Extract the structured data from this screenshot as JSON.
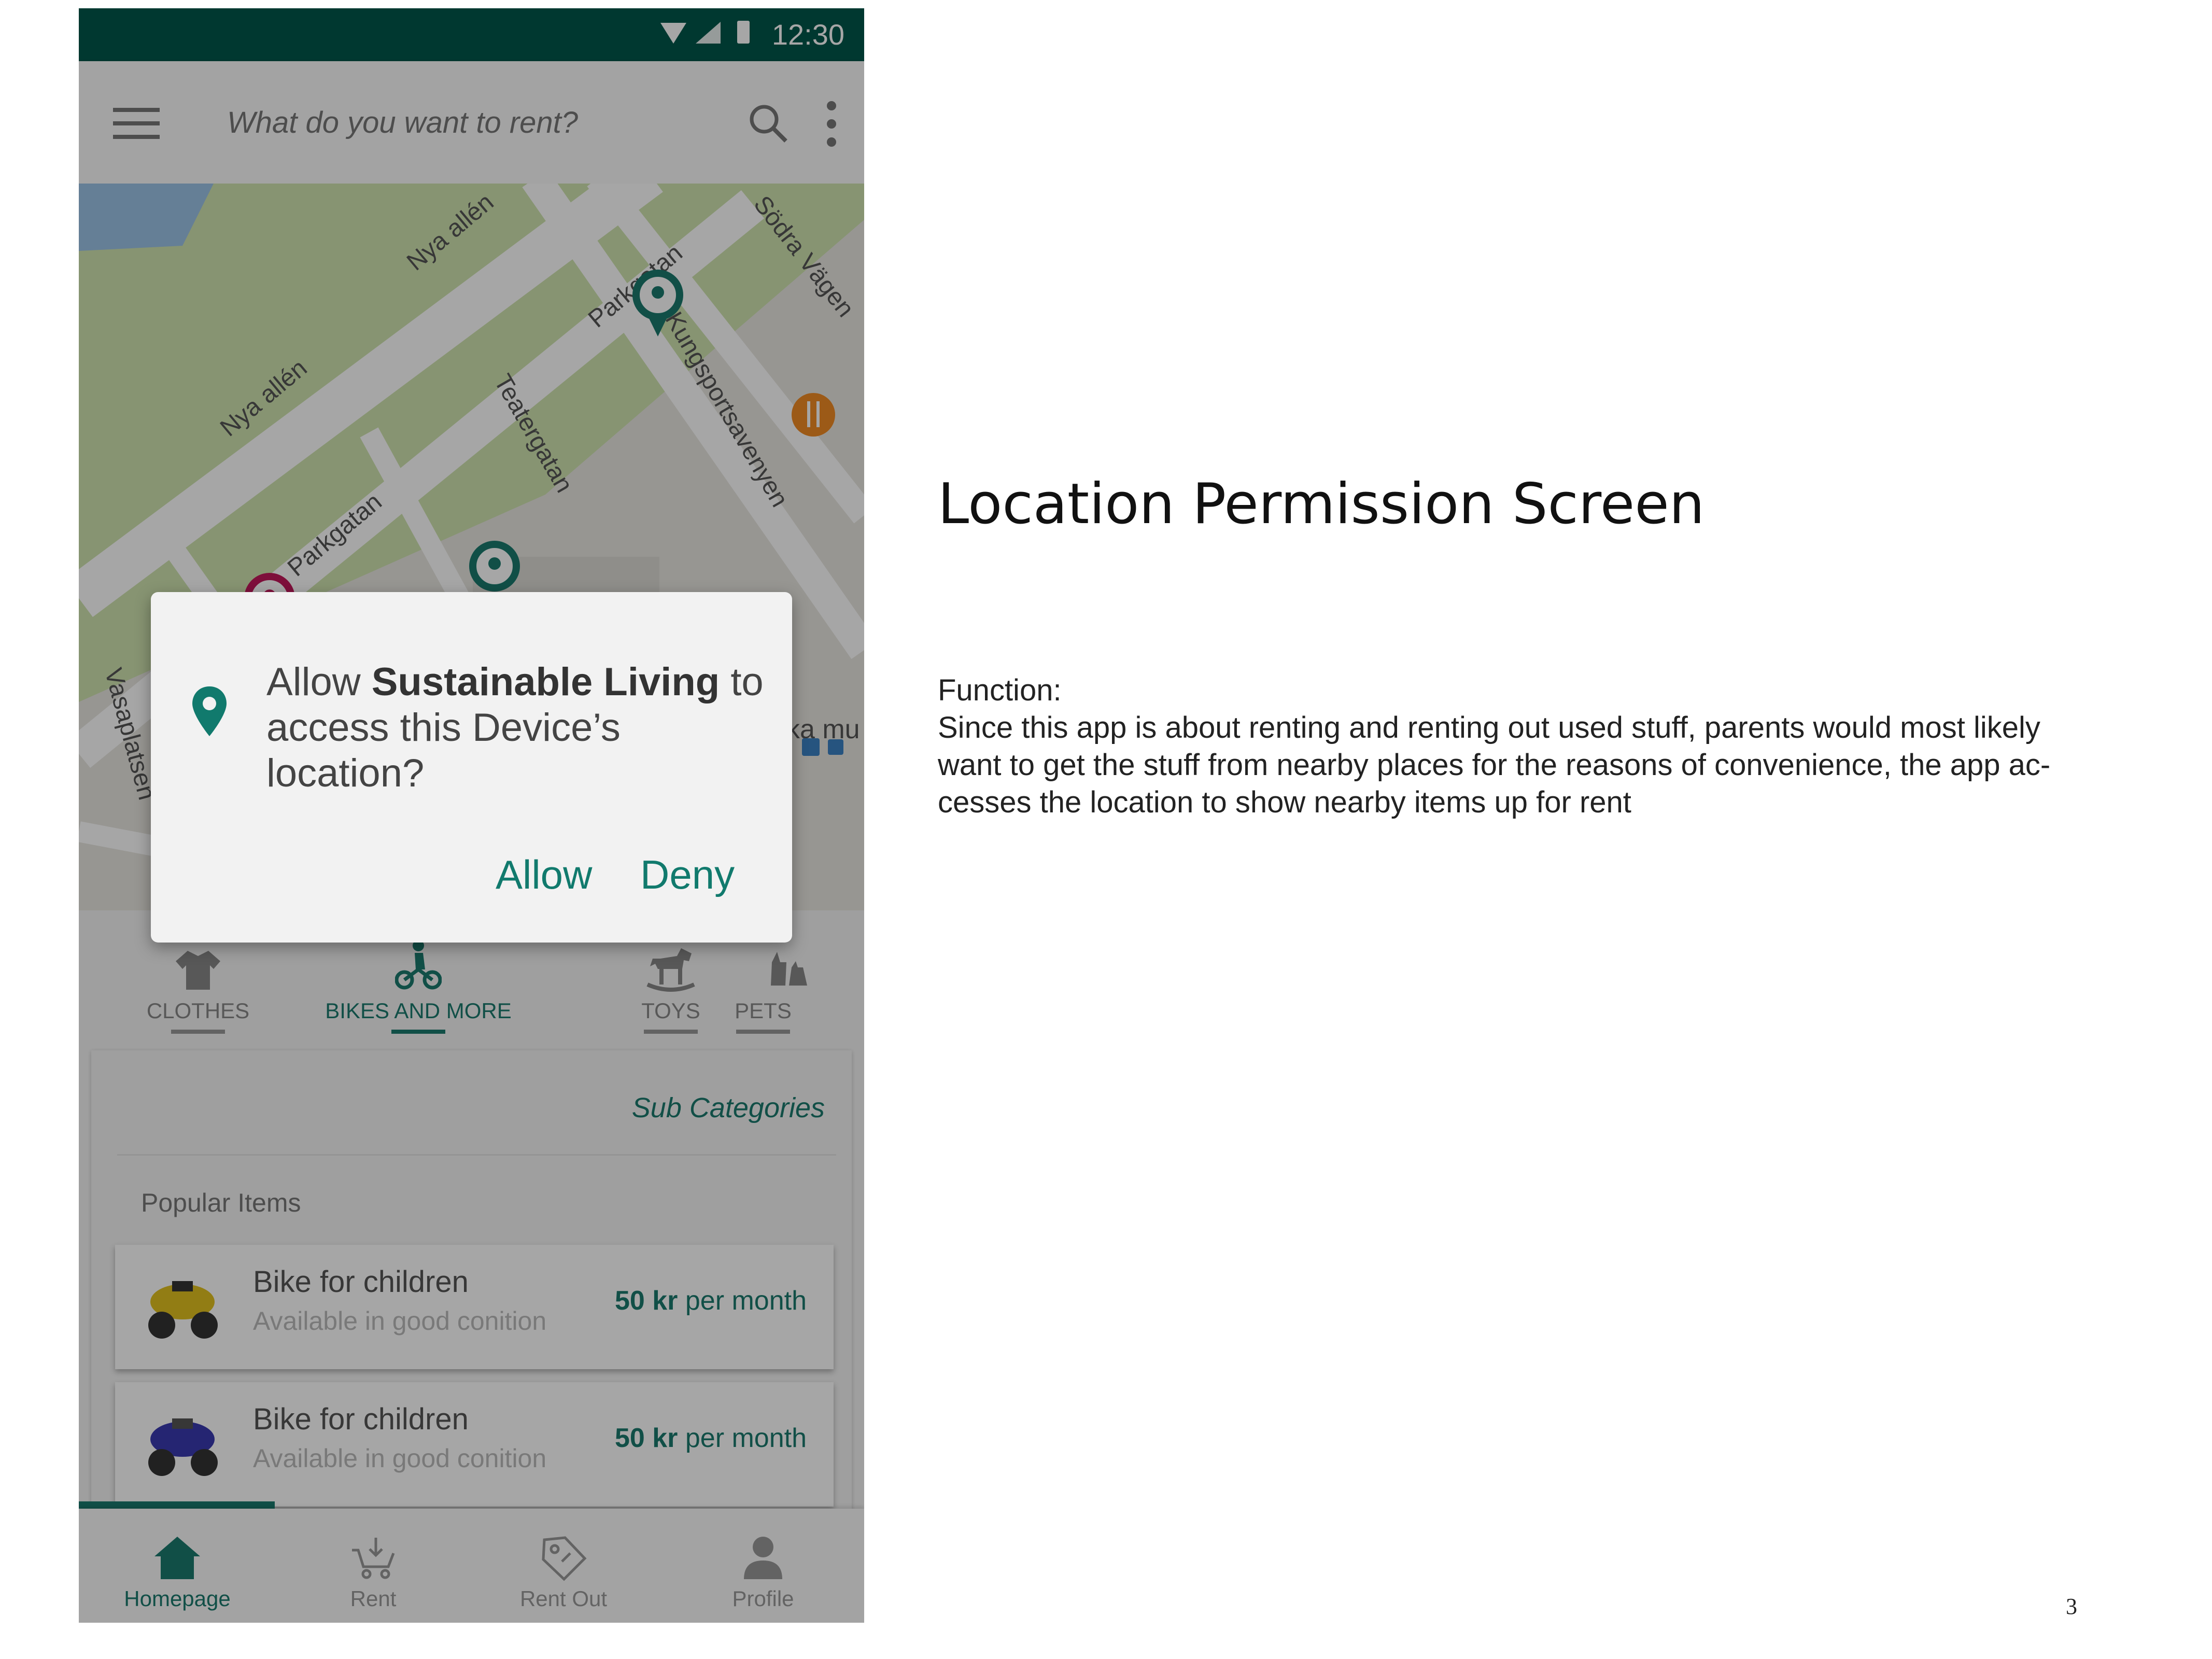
{
  "status_bar": {
    "time": "12:30"
  },
  "search": {
    "placeholder": "What do you want to rent?"
  },
  "map": {
    "street_labels": [
      "Nya allén",
      "Nya allén",
      "Parkgatan",
      "Parkgatan",
      "Kungsportsavenyen",
      "Teatergatan",
      "Södra Vägen",
      "Vasaplatsen",
      "ka mu"
    ]
  },
  "categories": [
    {
      "label": "CLOTHES",
      "icon": "shirt-icon",
      "active": false
    },
    {
      "label": "BIKES AND MORE",
      "icon": "bike-icon",
      "active": true
    },
    {
      "label": "TOYS",
      "icon": "rocking-horse-icon",
      "active": false
    },
    {
      "label": "PETS",
      "icon": "pets-icon",
      "active": false
    }
  ],
  "panel": {
    "subcategories_label": "Sub Categories",
    "popular_label": "Popular Items",
    "items": [
      {
        "title": "Bike for children",
        "subtitle": "Available in good conition",
        "price": "50 kr",
        "period": "per month"
      },
      {
        "title": "Bike for children",
        "subtitle": "Available in good conition",
        "price": "50 kr",
        "period": "per month"
      }
    ]
  },
  "bottom_nav": [
    {
      "label": "Homepage",
      "icon": "home-icon",
      "active": true
    },
    {
      "label": "Rent",
      "icon": "cart-icon",
      "active": false
    },
    {
      "label": "Rent Out",
      "icon": "tag-icon",
      "active": false
    },
    {
      "label": "Profile",
      "icon": "person-icon",
      "active": false
    }
  ],
  "dialog": {
    "prefix": "Allow ",
    "app_name": "Sustainable Living",
    "suffix": " to access this Device’s location?",
    "allow_label": "Allow",
    "deny_label": "Deny"
  },
  "annotation": {
    "title": "Location Permission Screen",
    "function_label": "Function:",
    "function_body": "Since this app is about renting and renting out used stuff, parents would most likely\nwant to get the stuff from nearby places for the reasons of convenience, the app ac-\ncesses the location to show nearby items up for rent",
    "page_number": "3"
  },
  "colors": {
    "primary": "#00574b",
    "accent": "#1b7a6e",
    "overlay": "rgba(0,0,0,0.35)"
  }
}
